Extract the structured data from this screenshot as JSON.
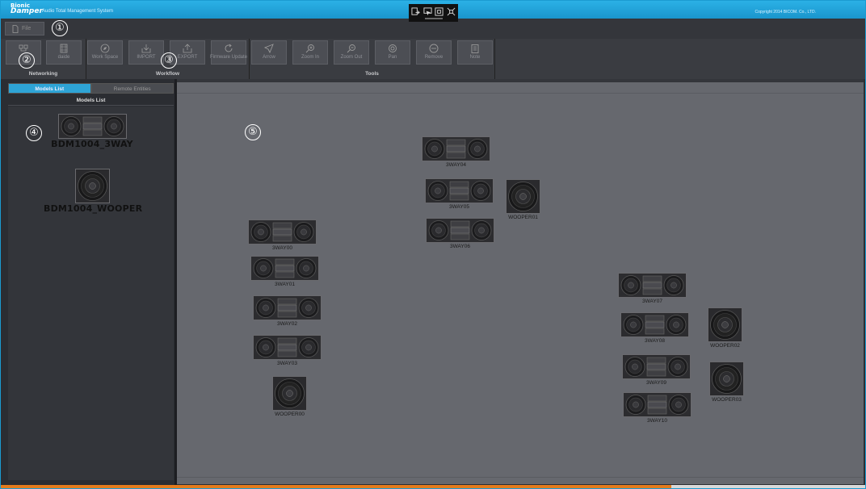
{
  "app": {
    "logo_line1": "Bionic",
    "logo_line2": "Damper",
    "subtitle": "Audio Total Management System",
    "copyright": "Copyright 2014 BICOM. Co., LTD."
  },
  "title_tools": [
    {
      "icon": "export-doc-icon"
    },
    {
      "icon": "monitor-arrow-icon"
    },
    {
      "icon": "square-target-icon"
    },
    {
      "icon": "crosshair-icon"
    }
  ],
  "menu": {
    "file_label": "File"
  },
  "ribbon": {
    "groups": [
      {
        "label": "Networking",
        "buttons": [
          {
            "label": "",
            "icon": "network-icon"
          },
          {
            "label": "daide",
            "icon": "film-icon"
          }
        ]
      },
      {
        "label": "Workflow",
        "buttons": [
          {
            "label": "Work Space",
            "icon": "compass-icon"
          },
          {
            "label": "IMPORT",
            "icon": "import-icon"
          },
          {
            "label": "EXPORT",
            "icon": "export-icon"
          },
          {
            "label": "Firmware Update",
            "icon": "refresh-icon"
          }
        ]
      },
      {
        "label": "Tools",
        "buttons": [
          {
            "label": "Arrow",
            "icon": "arrow-icon"
          },
          {
            "label": "Zoom In",
            "icon": "zoom-in-icon"
          },
          {
            "label": "Zoom Out",
            "icon": "zoom-out-icon"
          },
          {
            "label": "Pan",
            "icon": "pan-icon"
          },
          {
            "label": "Remove",
            "icon": "remove-icon"
          },
          {
            "label": "Note",
            "icon": "note-icon"
          }
        ]
      }
    ]
  },
  "left_panel": {
    "tabs": [
      {
        "label": "Models List",
        "active": true
      },
      {
        "label": "Remote Entities",
        "active": false
      }
    ],
    "header": "Models List",
    "models": [
      {
        "name": "BDM1004_3WAY",
        "type": "3way"
      },
      {
        "name": "BDM1004_WOOPER",
        "type": "wooper"
      }
    ]
  },
  "canvas": {
    "nodes": [
      {
        "label": "3WAY04",
        "type": "3way"
      },
      {
        "label": "3WAY05",
        "type": "3way"
      },
      {
        "label": "WOOPER01",
        "type": "wooper"
      },
      {
        "label": "3WAY06",
        "type": "3way"
      },
      {
        "label": "3WAY00",
        "type": "3way"
      },
      {
        "label": "3WAY01",
        "type": "3way"
      },
      {
        "label": "3WAY02",
        "type": "3way"
      },
      {
        "label": "3WAY03",
        "type": "3way"
      },
      {
        "label": "WOOPER00",
        "type": "wooper"
      },
      {
        "label": "3WAY07",
        "type": "3way"
      },
      {
        "label": "3WAY08",
        "type": "3way"
      },
      {
        "label": "WOOPER02",
        "type": "wooper"
      },
      {
        "label": "3WAY09",
        "type": "3way"
      },
      {
        "label": "WOOPER03",
        "type": "wooper"
      },
      {
        "label": "3WAY10",
        "type": "3way"
      }
    ]
  },
  "callouts": [
    "①",
    "②",
    "③",
    "④",
    "⑤"
  ],
  "colors": {
    "accent": "#1b9bd1",
    "canvas": "#66686e",
    "panel": "#2b2d32"
  }
}
